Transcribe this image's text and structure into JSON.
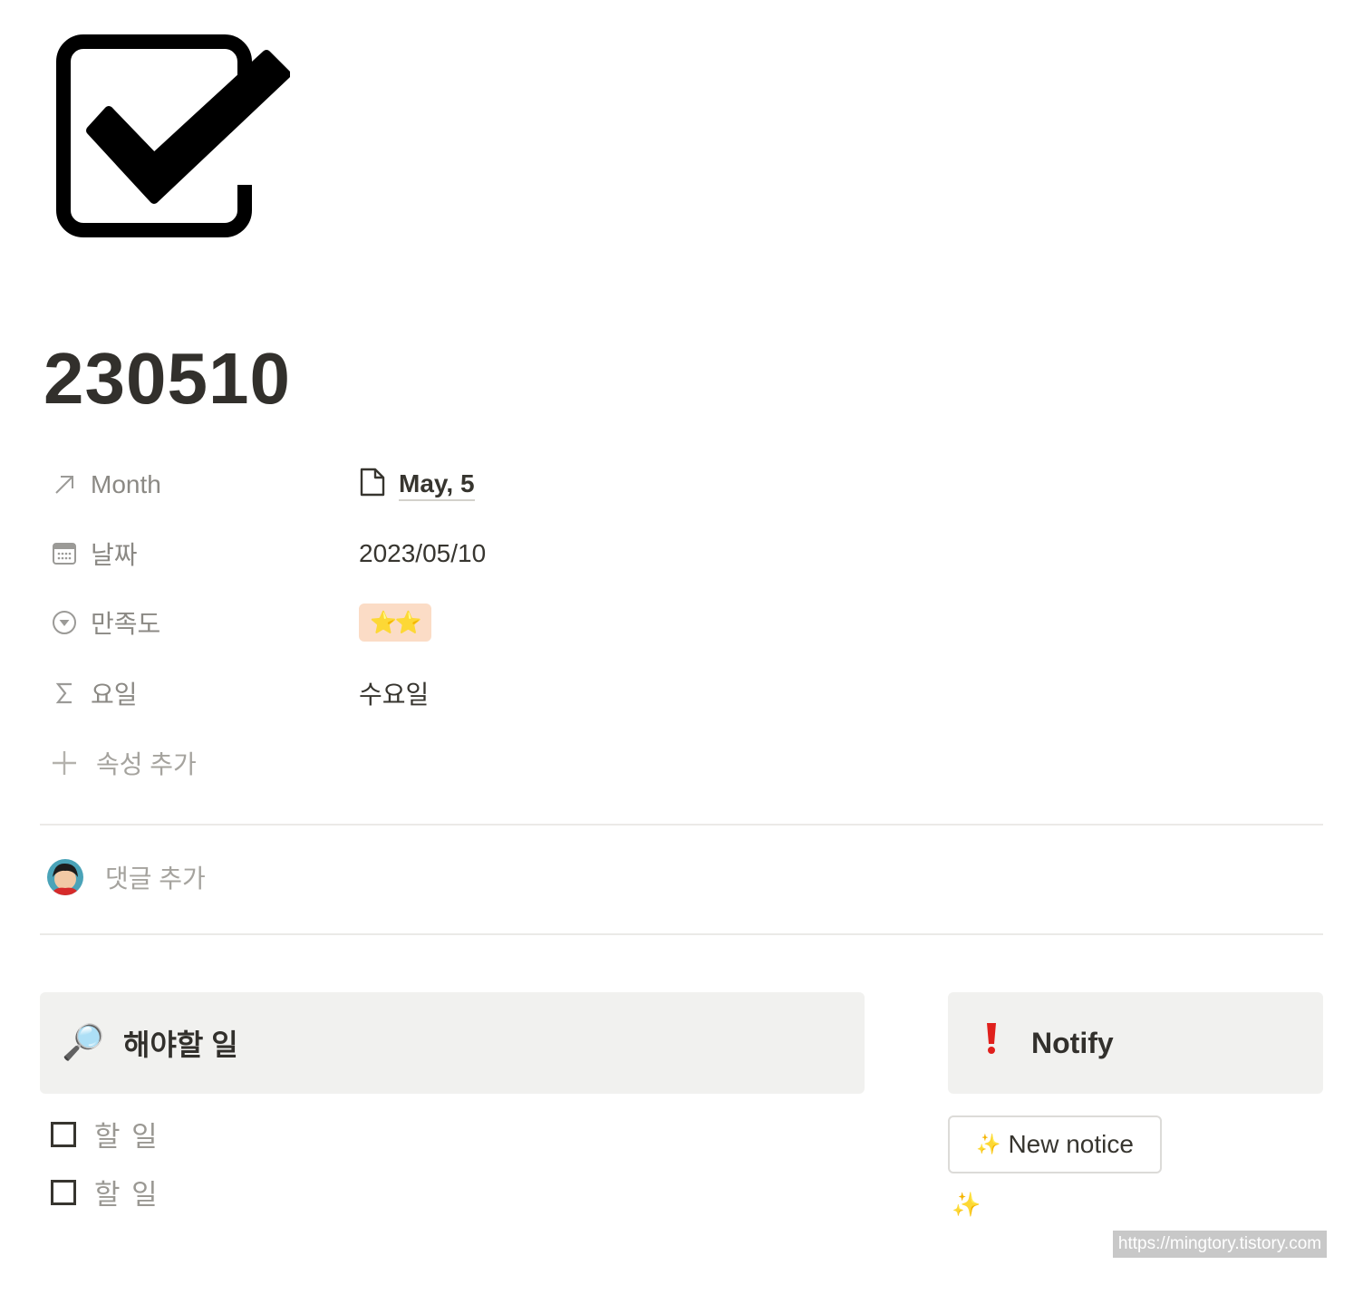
{
  "page": {
    "icon": "checkbox-checked-icon",
    "title": "230510"
  },
  "properties": [
    {
      "key": "Month",
      "icon": "arrow-up-right-icon",
      "value": "May, 5",
      "value_icon": "page-icon"
    },
    {
      "key": "날짜",
      "icon": "calendar-icon",
      "value": "2023/05/10"
    },
    {
      "key": "만족도",
      "icon": "select-icon",
      "value": "⭐⭐"
    },
    {
      "key": "요일",
      "icon": "sigma-icon",
      "value": "수요일"
    }
  ],
  "add_property": {
    "label": "속성 추가",
    "icon": "plus-icon"
  },
  "comment": {
    "placeholder": "댓글 추가",
    "avatar": "avatar"
  },
  "todo_callout": {
    "emoji": "🔎",
    "heading": "해야할 일"
  },
  "todos": [
    {
      "text": "할 일",
      "checked": false
    },
    {
      "text": "할 일",
      "checked": false
    }
  ],
  "notify_callout": {
    "emoji": "❗",
    "heading": "Notify"
  },
  "new_notice_button": {
    "emoji": "✨",
    "label": "New notice"
  },
  "sparkle_line": "✨",
  "watermark": "https://mingtory.tistory.com",
  "colors": {
    "select_bg": "#fbdcc6",
    "callout_bg": "#f1f1ef",
    "text": "#37352f",
    "muted": "#8b8984"
  }
}
